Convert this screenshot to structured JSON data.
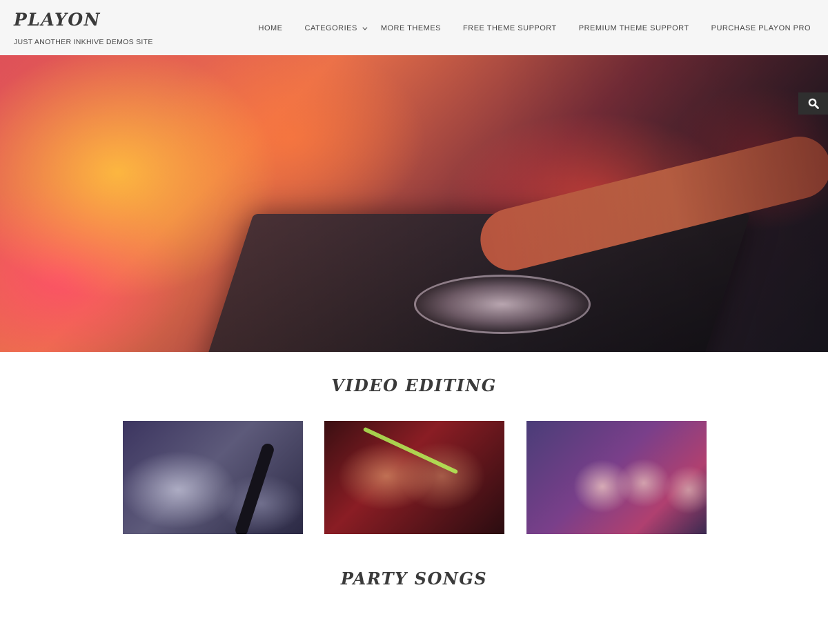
{
  "site": {
    "title": "PLAYON",
    "tagline": "JUST ANOTHER INKHIVE DEMOS SITE"
  },
  "nav": {
    "items": [
      {
        "label": "HOME"
      },
      {
        "label": "CATEGORIES",
        "has_dropdown": true
      },
      {
        "label": "MORE THEMES"
      },
      {
        "label": "FREE THEME SUPPORT"
      },
      {
        "label": "PREMIUM THEME SUPPORT"
      },
      {
        "label": "PURCHASE PLAYON PRO"
      }
    ]
  },
  "hero": {
    "image": "dj-mixer-hero-image",
    "search_icon": "search-icon"
  },
  "sections": [
    {
      "title": "VIDEO EDITING",
      "posts": [
        {
          "image": "party-crowd-fog-thumbnail"
        },
        {
          "image": "party-glowstick-friends-thumbnail"
        },
        {
          "image": "masquerade-party-thumbnail"
        }
      ]
    },
    {
      "title": "PARTY SONGS"
    }
  ],
  "colors": {
    "header_bg": "#f6f6f6",
    "text": "#3a3a3a",
    "search_button_bg": "#2f2f2f"
  }
}
